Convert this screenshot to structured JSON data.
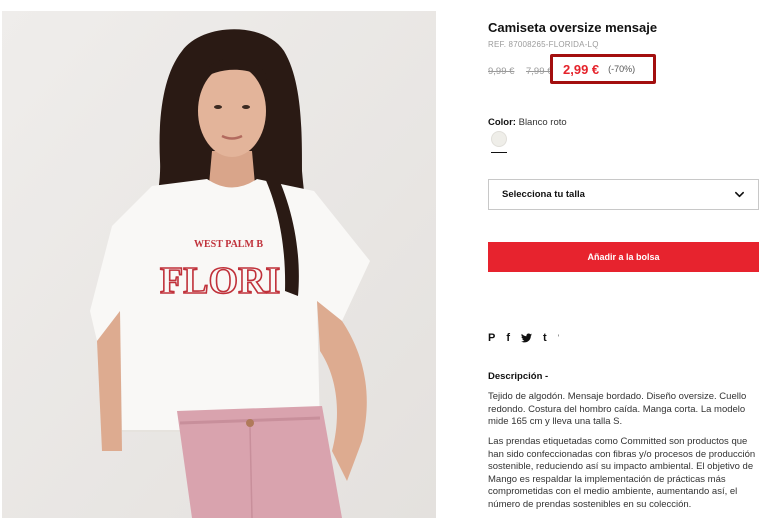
{
  "product": {
    "title": "Camiseta oversize mensaje",
    "ref": "REF. 87008265-FLORIDA-LQ",
    "print_text": {
      "line1": "WEST PALM B",
      "line2": "FLORI"
    }
  },
  "prices": {
    "original_1": "9,99 €",
    "original_2": "7,99 €",
    "current": "2,99 €",
    "discount": "(-70%)"
  },
  "color": {
    "label": "Color:",
    "value": "Blanco roto",
    "swatch_hex": "#efeee9"
  },
  "size_select": {
    "placeholder": "Selecciona tu talla"
  },
  "actions": {
    "add_to_bag": "Añadir a la bolsa"
  },
  "social": {
    "icons": [
      "pinterest-icon",
      "facebook-icon",
      "twitter-icon",
      "tumblr-icon"
    ],
    "pinterest": "P",
    "facebook": "f",
    "twitter": "🐦",
    "tumblr": "t",
    "extra": "'"
  },
  "description": {
    "title": "Descripción -",
    "paragraph1": "Tejido de algodón. Mensaje bordado. Diseño oversize. Cuello redondo. Costura del hombro caída. Manga corta. La modelo mide 165 cm y lleva una talla S.",
    "paragraph2": "Las prendas etiquetadas como Committed son productos que han sido confeccionadas con fibras y/o procesos de producción sostenible, reduciendo así su impacto ambiental. El objetivo de Mango es respaldar la implementación de prácticas más comprometidas con el medio ambiente, aumentando así, el número de prendas sostenibles en su colección."
  },
  "colors": {
    "accent_red": "#e7232e",
    "highlight_border": "#a30f0f",
    "price_red": "#e5232b"
  }
}
